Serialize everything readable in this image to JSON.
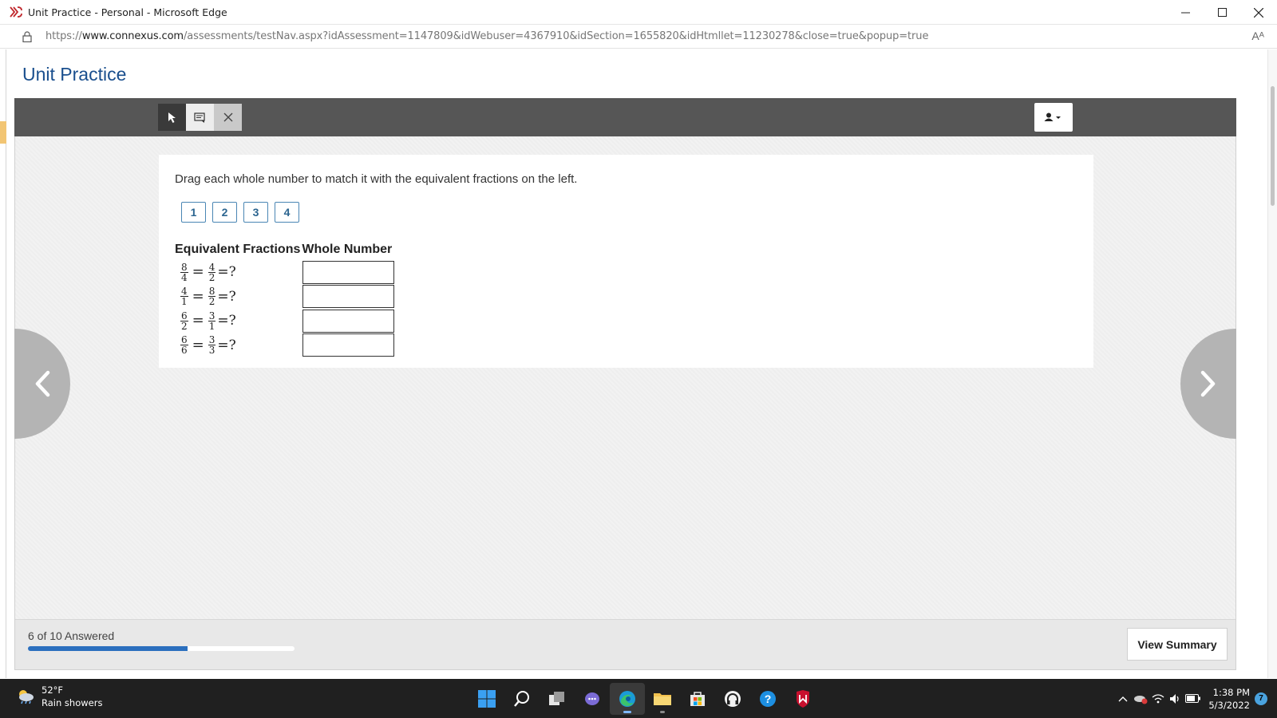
{
  "window": {
    "title": "Unit Practice - Personal - Microsoft Edge",
    "url_prefix": "https://",
    "url_host": "www.connexus.com",
    "url_path": "/assessments/testNav.aspx?idAssessment=1147809&idWebuser=4367910&idSection=1655820&idHtmllet=11230278&close=true&popup=true"
  },
  "page": {
    "title": "Unit Practice"
  },
  "question": {
    "prompt": "Drag each whole number to match it with the equivalent fractions on the left.",
    "choices": [
      "1",
      "2",
      "3",
      "4"
    ],
    "table": {
      "col_fractions": "Equivalent Fractions",
      "col_whole": "Whole Number",
      "rows": [
        {
          "a_num": "8",
          "a_den": "4",
          "b_num": "4",
          "b_den": "2",
          "answer": ""
        },
        {
          "a_num": "4",
          "a_den": "1",
          "b_num": "8",
          "b_den": "2",
          "answer": ""
        },
        {
          "a_num": "6",
          "a_den": "2",
          "b_num": "3",
          "b_den": "1",
          "answer": ""
        },
        {
          "a_num": "6",
          "a_den": "6",
          "b_num": "3",
          "b_den": "3",
          "answer": ""
        }
      ],
      "eq": "=",
      "unknown": "=?"
    }
  },
  "footer": {
    "answered_text": "6 of 10 Answered",
    "progress_fraction": 0.6,
    "view_summary": "View Summary"
  },
  "taskbar": {
    "temperature": "52°F",
    "weather": "Rain showers",
    "time": "1:38 PM",
    "date": "5/3/2022",
    "notifications": "7"
  },
  "colors": {
    "title_blue": "#1a4f8e",
    "chip_border": "#4a86b4",
    "progress_fill": "#2b6fbe",
    "toolbar": "#565656"
  }
}
